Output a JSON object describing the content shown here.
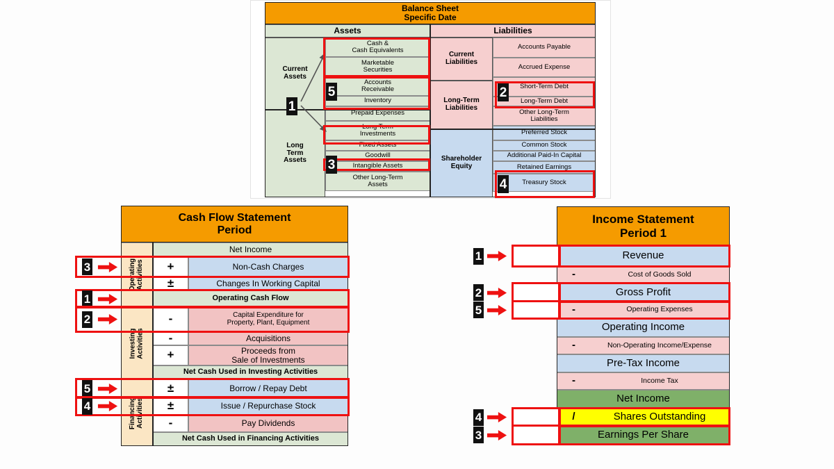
{
  "balance_sheet": {
    "title_line1": "Balance Sheet",
    "title_line2": "Specific Date",
    "headers": {
      "assets": "Assets",
      "liabilities": "Liabilities"
    },
    "groups": {
      "current_assets": "Current\nAssets",
      "long_term_assets": "Long\nTerm\nAssets",
      "current_liabilities": "Current\nLiabilities",
      "long_term_liabilities": "Long-Term\nLiabilities",
      "shareholder_equity": "Shareholder\nEquity"
    },
    "asset_items": [
      "Cash &\nCash Equivalents",
      "Marketable\nSecurities",
      "Accounts\nReceivable",
      "Inventory",
      "Prepaid Expenses",
      "Long Term\nInvestments",
      "Fixed Assets",
      "Goodwill",
      "Intangible Assets",
      "Other Long-Term\nAssets"
    ],
    "liability_items": [
      "Accounts Payable",
      "Accrued Expense",
      "Short-Term Debt",
      "Long-Term Debt",
      "Other Long-Term\nLiabilities",
      "Preferred Stock",
      "Common Stock",
      "Additional Paid-In Capital",
      "Retained Earnings",
      "Treasury Stock"
    ],
    "badges": [
      {
        "n": "1",
        "target": "current-assets"
      },
      {
        "n": "5",
        "target": "accounts-receivable-inventory"
      },
      {
        "n": "3",
        "target": "goodwill"
      },
      {
        "n": "2",
        "target": "short-term-and-long-term-debt"
      },
      {
        "n": "4",
        "target": "retained-earnings-treasury-stock"
      }
    ]
  },
  "cash_flow": {
    "title_line1": "Cash Flow Statement",
    "title_line2": "Period",
    "sections": {
      "operating": "Operating\nActivities",
      "investing": "Investing\nActivities",
      "financing": "Financing\nActivities"
    },
    "rows": [
      {
        "sign": "",
        "label": "Net Income",
        "tone": "green",
        "bold": false,
        "badge": null
      },
      {
        "sign": "+",
        "label": "Non-Cash Charges",
        "tone": "blue",
        "bold": false,
        "badge": "3"
      },
      {
        "sign": "±",
        "label": "Changes In Working Capital",
        "tone": "blue",
        "bold": false,
        "badge": null
      },
      {
        "sign": "",
        "label": "Operating Cash Flow",
        "tone": "green",
        "bold": true,
        "badge": "1"
      },
      {
        "sign": "-",
        "label": "Capital Expenditure for\nProperty, Plant, Equipment",
        "tone": "pink",
        "bold": false,
        "badge": "2"
      },
      {
        "sign": "-",
        "label": "Acquisitions",
        "tone": "pink",
        "bold": false,
        "badge": null
      },
      {
        "sign": "+",
        "label": "Proceeds from\nSale of Investments",
        "tone": "pink",
        "bold": false,
        "badge": null
      },
      {
        "sign": "",
        "label": "Net Cash Used in Investing Activities",
        "tone": "green",
        "bold": true,
        "badge": null
      },
      {
        "sign": "±",
        "label": "Borrow / Repay Debt",
        "tone": "blue",
        "bold": false,
        "badge": "5"
      },
      {
        "sign": "±",
        "label": "Issue / Repurchase Stock",
        "tone": "blue",
        "bold": false,
        "badge": "4"
      },
      {
        "sign": "-",
        "label": "Pay Dividends",
        "tone": "pink",
        "bold": false,
        "badge": null
      },
      {
        "sign": "",
        "label": "Net Cash Used in Financing Activities",
        "tone": "green",
        "bold": true,
        "badge": null
      }
    ]
  },
  "income_statement": {
    "title_line1": "Income Statement",
    "title_line2": "Period 1",
    "rows": [
      {
        "sign": "",
        "label": "Revenue",
        "tone": "blue",
        "big": true,
        "badge": "1"
      },
      {
        "sign": "-",
        "label": "Cost of Goods Sold",
        "tone": "pink",
        "big": false,
        "badge": null
      },
      {
        "sign": "",
        "label": "Gross Profit",
        "tone": "blue",
        "big": true,
        "badge": "2"
      },
      {
        "sign": "-",
        "label": "Operating Expenses",
        "tone": "pink",
        "big": false,
        "badge": "5"
      },
      {
        "sign": "",
        "label": "Operating Income",
        "tone": "blue",
        "big": true,
        "badge": null
      },
      {
        "sign": "-",
        "label": "Non-Operating Income/Expense",
        "tone": "pink",
        "big": false,
        "badge": null
      },
      {
        "sign": "",
        "label": "Pre-Tax Income",
        "tone": "blue",
        "big": true,
        "badge": null
      },
      {
        "sign": "-",
        "label": "Income Tax",
        "tone": "pink",
        "big": false,
        "badge": null
      },
      {
        "sign": "",
        "label": "Net Income",
        "tone": "darkgreen",
        "big": true,
        "badge": null
      },
      {
        "sign": "/",
        "label": "Shares Outstanding",
        "tone": "yellow",
        "big": true,
        "badge": "4"
      },
      {
        "sign": "",
        "label": "Earnings Per Share",
        "tone": "darkgreen",
        "big": true,
        "badge": "3"
      }
    ]
  },
  "colors": {
    "header_orange": "#f59b00",
    "assets_green": "#dce7d4",
    "liabilities_pink": "#f6cfcf",
    "equity_blue": "#c7daef",
    "net_income_green": "#7fb069",
    "shares_yellow": "#ffff00",
    "sidebar_cream": "#fbe6c4",
    "highlight_red": "#ee1111"
  }
}
